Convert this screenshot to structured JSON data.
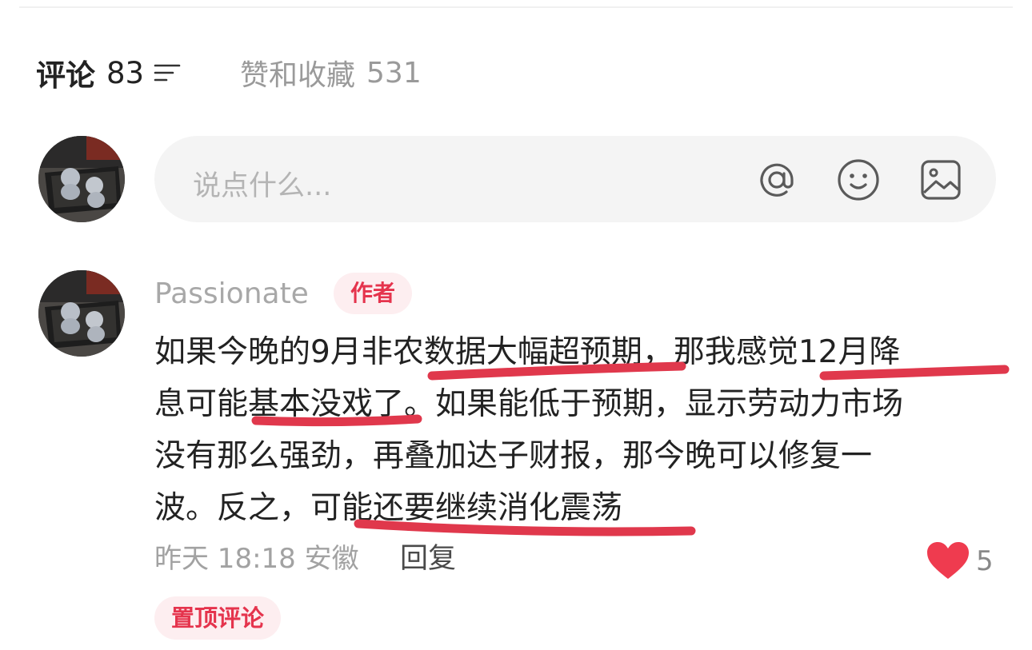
{
  "tabs": {
    "comments_label": "评论",
    "comments_count": "83",
    "likes_label": "赞和收藏",
    "likes_count": "531"
  },
  "input": {
    "placeholder": "说点什么..."
  },
  "icons": {
    "sort": "sort-icon",
    "mention": "at-icon",
    "emoji": "smiley-icon",
    "image": "image-icon",
    "like": "heart-icon"
  },
  "comment": {
    "username": "Passionate",
    "author_badge": "作者",
    "lines": [
      "如果今晚的9月非农数据大幅超预期，那我感觉12月降",
      "息可能基本没戏了。如果能低于预期，显示劳动力市场",
      "没有那么强劲，再叠加达子财报，那今晚可以修复一",
      "波。反之，可能还要继续消化震荡"
    ],
    "time": "昨天 18:18",
    "location": "安徽",
    "reply_label": "回复",
    "like_count": "5",
    "pinned_label": "置顶评论"
  },
  "colors": {
    "accent": "#e5344d",
    "underline": "#e0384c",
    "like": "#ef3b4f"
  }
}
